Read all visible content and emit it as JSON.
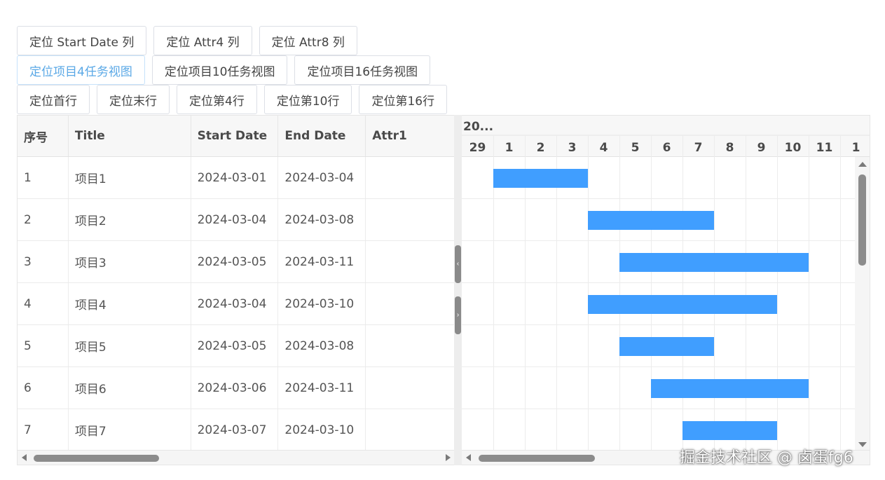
{
  "toolbar": {
    "row1": [
      "定位 Start Date 列",
      "定位 Attr4 列",
      "定位 Attr8 列"
    ],
    "row2": [
      "定位项目4任务视图",
      "定位项目10任务视图",
      "定位项目16任务视图"
    ],
    "row3": [
      "定位首行",
      "定位末行",
      "定位第4行",
      "定位第10行",
      "定位第16行"
    ]
  },
  "table": {
    "columns": [
      "序号",
      "Title",
      "Start Date",
      "End Date",
      "Attr1"
    ],
    "rows": [
      {
        "no": "1",
        "title": "项目1",
        "start": "2024-03-01",
        "end": "2024-03-04",
        "attr1": ""
      },
      {
        "no": "2",
        "title": "项目2",
        "start": "2024-03-04",
        "end": "2024-03-08",
        "attr1": ""
      },
      {
        "no": "3",
        "title": "项目3",
        "start": "2024-03-05",
        "end": "2024-03-11",
        "attr1": ""
      },
      {
        "no": "4",
        "title": "项目4",
        "start": "2024-03-04",
        "end": "2024-03-10",
        "attr1": ""
      },
      {
        "no": "5",
        "title": "项目5",
        "start": "2024-03-05",
        "end": "2024-03-08",
        "attr1": ""
      },
      {
        "no": "6",
        "title": "项目6",
        "start": "2024-03-06",
        "end": "2024-03-11",
        "attr1": ""
      },
      {
        "no": "7",
        "title": "项目7",
        "start": "2024-03-07",
        "end": "2024-03-10",
        "attr1": ""
      }
    ]
  },
  "gantt": {
    "year_label": "20...",
    "days": [
      "29",
      "1",
      "2",
      "3",
      "4",
      "5",
      "6",
      "7",
      "8",
      "9",
      "10",
      "11",
      "1"
    ],
    "bars": [
      {
        "start": "2024-03-01",
        "end": "2024-03-04"
      },
      {
        "start": "2024-03-04",
        "end": "2024-03-08"
      },
      {
        "start": "2024-03-05",
        "end": "2024-03-11"
      },
      {
        "start": "2024-03-04",
        "end": "2024-03-10"
      },
      {
        "start": "2024-03-05",
        "end": "2024-03-08"
      },
      {
        "start": "2024-03-06",
        "end": "2024-03-11"
      },
      {
        "start": "2024-03-07",
        "end": "2024-03-10"
      }
    ],
    "bar_color": "#409eff"
  },
  "splitter": {
    "collapse_glyph": "‹",
    "expand_glyph": "›"
  },
  "watermark": "掘金技术社区 @ 卤蛋fg6"
}
